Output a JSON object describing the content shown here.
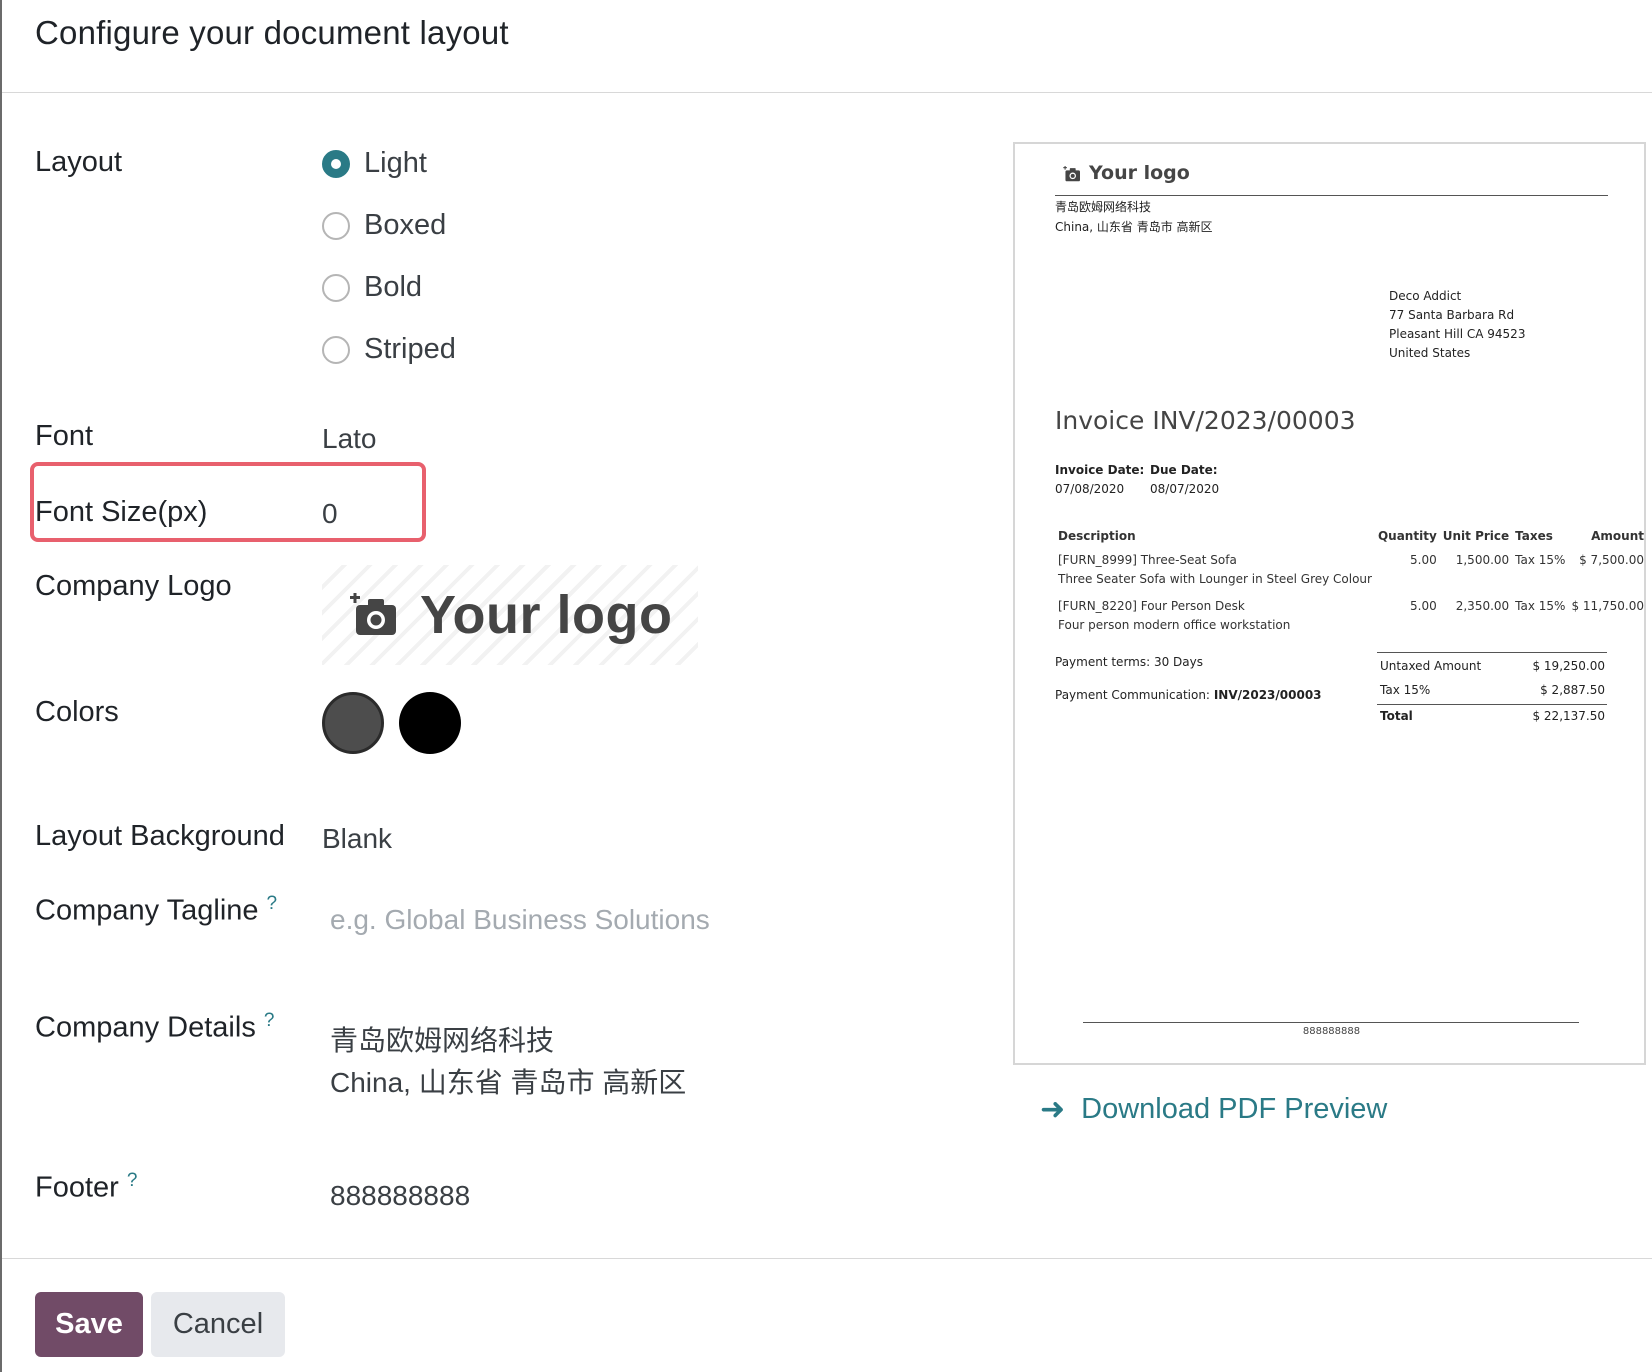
{
  "title": "Configure your document layout",
  "layout": {
    "label": "Layout",
    "options": [
      "Light",
      "Boxed",
      "Bold",
      "Striped"
    ],
    "selected": "Light"
  },
  "font": {
    "label": "Font",
    "value": "Lato"
  },
  "font_size": {
    "label": "Font Size(px)",
    "value": "0"
  },
  "company_logo": {
    "label": "Company Logo",
    "text": "Your logo",
    "icon": "camera-plus-icon"
  },
  "colors": {
    "label": "Colors",
    "primary": "#4d4d4d",
    "secondary": "#000000"
  },
  "layout_background": {
    "label": "Layout Background",
    "value": "Blank"
  },
  "company_tagline": {
    "label": "Company Tagline",
    "help": "?",
    "placeholder": "e.g. Global Business Solutions"
  },
  "company_details": {
    "label": "Company Details",
    "help": "?",
    "line1": "青岛欧姆网络科技",
    "line2": "China, 山东省 青岛市 高新区"
  },
  "footer": {
    "label": "Footer",
    "help": "?",
    "value": "888888888"
  },
  "buttons": {
    "save": "Save",
    "cancel": "Cancel"
  },
  "download_link": "Download PDF Preview",
  "preview": {
    "logo_text": "Your logo",
    "company_line1": "青岛欧姆网络科技",
    "company_line2": "China, 山东省 青岛市 高新区",
    "customer": {
      "name": "Deco Addict",
      "street": "77 Santa Barbara Rd",
      "city": "Pleasant Hill CA 94523",
      "country": "United States"
    },
    "invoice_title": "Invoice INV/2023/00003",
    "invoice_date_label": "Invoice Date:",
    "invoice_date": "07/08/2020",
    "due_date_label": "Due Date:",
    "due_date": "08/07/2020",
    "table": {
      "headers": [
        "Description",
        "Quantity",
        "Unit Price",
        "Taxes",
        "Amount"
      ],
      "rows": [
        {
          "desc": "[FURN_8999] Three-Seat Sofa",
          "desc2": "Three Seater Sofa with Lounger in Steel Grey Colour",
          "qty": "5.00",
          "price": "1,500.00",
          "tax": "Tax 15%",
          "amount": "$ 7,500.00"
        },
        {
          "desc": "[FURN_8220] Four Person Desk",
          "desc2": "Four person modern office workstation",
          "qty": "5.00",
          "price": "2,350.00",
          "tax": "Tax 15%",
          "amount": "$ 11,750.00"
        }
      ]
    },
    "payment_terms": "Payment terms: 30 Days",
    "payment_comm_label": "Payment Communication:",
    "payment_comm_value": "INV/2023/00003",
    "totals": {
      "untaxed_label": "Untaxed Amount",
      "untaxed": "$ 19,250.00",
      "tax_label": "Tax 15%",
      "tax": "$ 2,887.50",
      "total_label": "Total",
      "total": "$ 22,137.50"
    },
    "footer": "888888888"
  }
}
